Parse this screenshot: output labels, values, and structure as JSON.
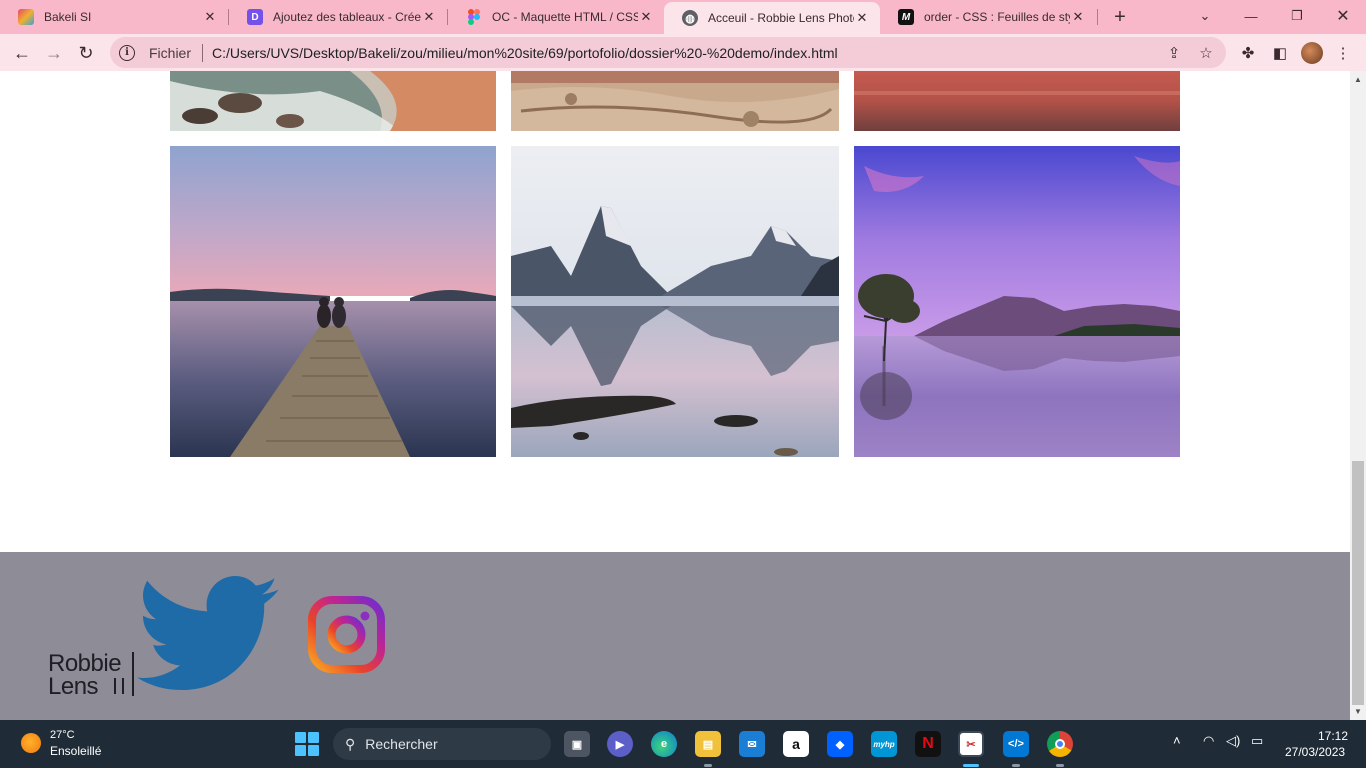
{
  "browser": {
    "tabs": [
      {
        "title": "Bakeli SI",
        "favicon": "bakeli-logo-icon",
        "active": false
      },
      {
        "title": "Ajoutez des tableaux - Créez",
        "favicon": "openclassrooms-icon",
        "active": false
      },
      {
        "title": "OC - Maquette HTML / CSS d",
        "favicon": "figma-icon",
        "active": false
      },
      {
        "title": "Acceuil - Robbie Lens Photog",
        "favicon": "globe-icon",
        "active": true
      },
      {
        "title": "order - CSS : Feuilles de style",
        "favicon": "mdn-icon",
        "active": false
      }
    ],
    "address_label": "Fichier",
    "url": "C:/Users/UVS/Desktop/Bakeli/zou/milieu/mon%20site/69/portofolio/dossier%20-%20demo/index.html"
  },
  "page": {
    "gallery": [
      {
        "name": "beach-rocks-photo",
        "row": 1
      },
      {
        "name": "rock-texture-photo",
        "row": 1
      },
      {
        "name": "red-water-photo",
        "row": 1
      },
      {
        "name": "pier-couple-sunset-photo",
        "row": 2
      },
      {
        "name": "mountain-lake-reflection-photo",
        "row": 2
      },
      {
        "name": "purple-lake-tree-photo",
        "row": 2
      }
    ],
    "footer": {
      "logo_line1": "Robbie",
      "logo_line2": "Lens",
      "social": [
        "twitter-icon",
        "instagram-icon"
      ]
    }
  },
  "taskbar": {
    "weather_temp": "27°C",
    "weather_desc": "Ensoleillé",
    "search_placeholder": "Rechercher",
    "apps": [
      "task-view-icon",
      "teams-icon",
      "edge-icon",
      "file-explorer-icon",
      "mail-icon",
      "amazon-icon",
      "dropbox-icon",
      "myhp-icon",
      "netflix-icon",
      "snipping-tool-icon",
      "vscode-icon",
      "chrome-icon"
    ],
    "time": "17:12",
    "date": "27/03/2023"
  },
  "colors": {
    "tabstrip": "#f9b8c9",
    "toolbar": "#fbe4ea",
    "footer": "#8e8c97",
    "twitter_blue": "#1e6ba8",
    "taskbar": "#1f2b36"
  }
}
